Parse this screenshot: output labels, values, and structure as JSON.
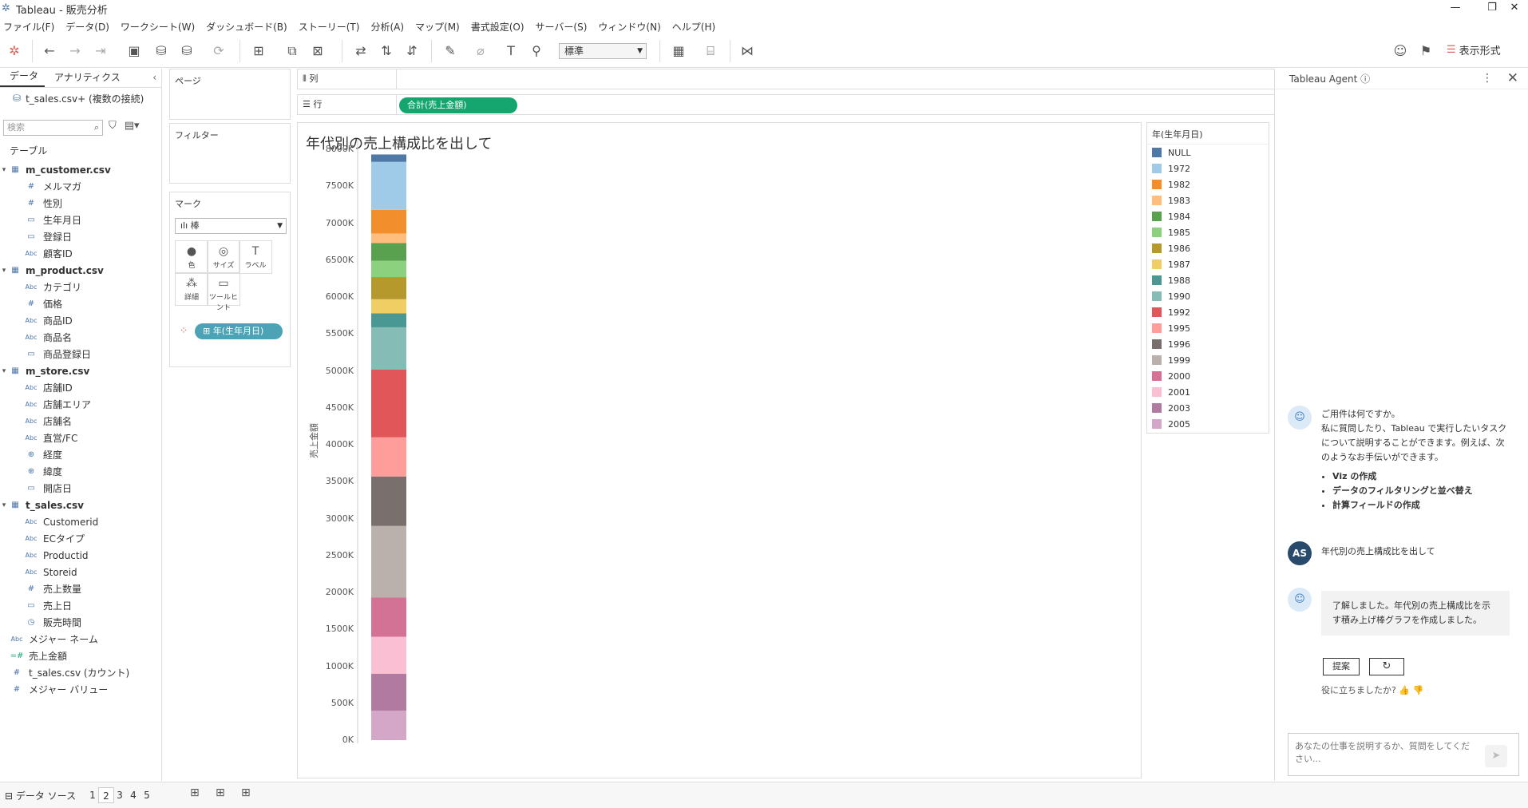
{
  "window": {
    "title": "Tableau - 販売分析",
    "min": "—",
    "max": "❐",
    "close": "✕"
  },
  "menu": [
    "ファイル(F)",
    "データ(D)",
    "ワークシート(W)",
    "ダッシュボード(B)",
    "ストーリー(T)",
    "分析(A)",
    "マップ(M)",
    "書式設定(O)",
    "サーバー(S)",
    "ウィンドウ(N)",
    "ヘルプ(H)"
  ],
  "toolbar": {
    "fit": "標準",
    "show_me": "表示形式"
  },
  "data_pane": {
    "tab_data": "データ",
    "tab_analytics": "アナリティクス",
    "collapse": "‹",
    "connection": "t_sales.csv+ (複数の接続)",
    "search_placeholder": "検索",
    "tables_header": "テーブル",
    "rows": [
      {
        "kind": "table",
        "label": "m_customer.csv"
      },
      {
        "kind": "field",
        "type": "#",
        "label": "メルマガ"
      },
      {
        "kind": "field",
        "type": "#",
        "label": "性別"
      },
      {
        "kind": "field",
        "type": "date",
        "label": "生年月日"
      },
      {
        "kind": "field",
        "type": "date",
        "label": "登録日"
      },
      {
        "kind": "field",
        "type": "Abc",
        "label": "顧客ID"
      },
      {
        "kind": "table",
        "label": "m_product.csv"
      },
      {
        "kind": "field",
        "type": "Abc",
        "label": "カテゴリ"
      },
      {
        "kind": "field",
        "type": "#",
        "label": "価格"
      },
      {
        "kind": "field",
        "type": "Abc",
        "label": "商品ID"
      },
      {
        "kind": "field",
        "type": "Abc",
        "label": "商品名"
      },
      {
        "kind": "field",
        "type": "date",
        "label": "商品登録日"
      },
      {
        "kind": "table",
        "label": "m_store.csv"
      },
      {
        "kind": "field",
        "type": "Abc",
        "label": "店舗ID"
      },
      {
        "kind": "field",
        "type": "Abc",
        "label": "店舗エリア"
      },
      {
        "kind": "field",
        "type": "Abc",
        "label": "店舗名"
      },
      {
        "kind": "field",
        "type": "Abc",
        "label": "直営/FC"
      },
      {
        "kind": "field",
        "type": "geo",
        "label": "経度"
      },
      {
        "kind": "field",
        "type": "geo",
        "label": "緯度"
      },
      {
        "kind": "field",
        "type": "date",
        "label": "開店日"
      },
      {
        "kind": "table",
        "label": "t_sales.csv"
      },
      {
        "kind": "field",
        "type": "Abc",
        "label": "Customerid"
      },
      {
        "kind": "field",
        "type": "Abc",
        "label": "ECタイプ"
      },
      {
        "kind": "field",
        "type": "Abc",
        "label": "Productid"
      },
      {
        "kind": "field",
        "type": "Abc",
        "label": "Storeid"
      },
      {
        "kind": "field",
        "type": "#",
        "label": "売上数量"
      },
      {
        "kind": "field",
        "type": "date",
        "label": "売上日"
      },
      {
        "kind": "field",
        "type": "datetime",
        "label": "販売時間"
      },
      {
        "kind": "top",
        "type": "Abc",
        "label": "メジャー ネーム"
      },
      {
        "kind": "top",
        "type": "meas",
        "label": "売上金額"
      },
      {
        "kind": "top",
        "type": "#",
        "label": "t_sales.csv (カウント)"
      },
      {
        "kind": "top",
        "type": "#",
        "label": "メジャー バリュー"
      }
    ]
  },
  "cards": {
    "pages": "ページ",
    "filters": "フィルター",
    "marks": "マーク",
    "mark_type": "棒",
    "mark_buttons": [
      {
        "name": "color",
        "icon": "●",
        "label": "色"
      },
      {
        "name": "size",
        "icon": "◎",
        "label": "サイズ"
      },
      {
        "name": "label",
        "icon": "T",
        "label": "ラベル"
      },
      {
        "name": "detail",
        "icon": "⁂",
        "label": "詳細"
      },
      {
        "name": "tooltip",
        "icon": "▭",
        "label": "ツールヒント"
      }
    ],
    "color_pill": "⊞ 年(生年月日)"
  },
  "shelves": {
    "columns": "列",
    "rows": "行",
    "row_pill": "合計(売上金額)"
  },
  "chart_data": {
    "type": "bar",
    "stacked": true,
    "title": "年代別の売上構成比を出して",
    "ylabel": "売上金額",
    "yticks": [
      "0K",
      "500K",
      "1000K",
      "1500K",
      "2000K",
      "2500K",
      "3000K",
      "3500K",
      "4000K",
      "4500K",
      "5000K",
      "5500K",
      "6000K",
      "6500K",
      "7000K",
      "7500K",
      "8000K"
    ],
    "ylim": [
      0,
      8000
    ],
    "legend_title": "年(生年月日)",
    "series": [
      {
        "name": "NULL",
        "value": 100,
        "color": "#4e79a7"
      },
      {
        "name": "1972",
        "value": 650,
        "color": "#a0cbe8"
      },
      {
        "name": "1982",
        "value": 320,
        "color": "#f28e2b"
      },
      {
        "name": "1983",
        "value": 130,
        "color": "#ffbe7d"
      },
      {
        "name": "1984",
        "value": 240,
        "color": "#59a14f"
      },
      {
        "name": "1985",
        "value": 220,
        "color": "#8cd17d"
      },
      {
        "name": "1986",
        "value": 300,
        "color": "#b6992d"
      },
      {
        "name": "1987",
        "value": 190,
        "color": "#f1ce63"
      },
      {
        "name": "1988",
        "value": 190,
        "color": "#499894"
      },
      {
        "name": "1990",
        "value": 570,
        "color": "#86bcb6"
      },
      {
        "name": "1992",
        "value": 920,
        "color": "#e15759"
      },
      {
        "name": "1995",
        "value": 530,
        "color": "#ff9d9a"
      },
      {
        "name": "1996",
        "value": 670,
        "color": "#79706e"
      },
      {
        "name": "1999",
        "value": 970,
        "color": "#bab0ac"
      },
      {
        "name": "2000",
        "value": 530,
        "color": "#d37295"
      },
      {
        "name": "2001",
        "value": 500,
        "color": "#fabfd2"
      },
      {
        "name": "2003",
        "value": 500,
        "color": "#b07aa1"
      },
      {
        "name": "2005",
        "value": 400,
        "color": "#d4a6c8"
      }
    ]
  },
  "agent": {
    "title": "Tableau Agent ⓘ",
    "more": "⋮",
    "close": "✕",
    "greeting_line1": "ご用件は何ですか。",
    "greeting_line2": "私に質問したり、Tableau で実行したいタスクについて説明することができます。例えば、次のようなお手伝いができます。",
    "bullets": [
      "Viz の作成",
      "データのフィルタリングと並べ替え",
      "計算フィールドの作成"
    ],
    "user_initials": "AS",
    "user_message": "年代別の売上構成比を出して",
    "reply": "了解しました。年代別の売上構成比を示す積み上げ棒グラフを作成しました。",
    "suggest": "提案",
    "refresh": "↻",
    "helpful": "役に立ちましたか?  👍  👎",
    "input_placeholder": "あなたの仕事を説明するか、質問をしてください...",
    "send": "➤"
  },
  "bottom": {
    "datasource": "⊟ データ ソース",
    "sheets": [
      "1",
      "2",
      "3",
      "4",
      "5"
    ],
    "active_sheet": "2"
  }
}
